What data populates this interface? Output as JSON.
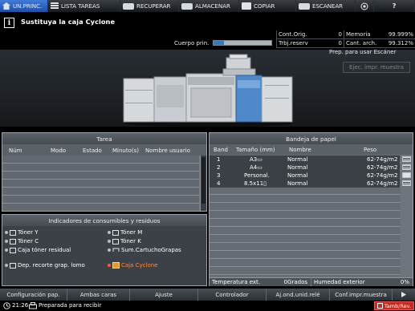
{
  "topbar": {
    "tabs": [
      {
        "label": "UN.PRINC.",
        "icon": "home-icon",
        "active": true
      },
      {
        "label": "LISTA TAREAS",
        "icon": "list-icon",
        "active": false
      },
      {
        "label": "RECUPERAR",
        "icon": "printer-icon",
        "active": false
      },
      {
        "label": "ALMACENAR",
        "icon": "printer-icon",
        "active": false
      },
      {
        "label": "COPIAR",
        "icon": "copy-icon",
        "active": false
      },
      {
        "label": "ESCANEAR",
        "icon": "scanner-icon",
        "active": false
      }
    ],
    "globe_icon": "globe-icon",
    "help_label": "?"
  },
  "message": {
    "icon": "info-icon",
    "text": "Sustituya la caja Cyclone",
    "main_body_label": "Cuerpo prin.",
    "main_body_progress": 0.18
  },
  "counters": {
    "cont_orig_label": "Cont.Orig.",
    "cont_orig_value": "0",
    "memoria_label": "Memoria",
    "memoria_value": "99.999%",
    "trbj_reserv_label": "Trbj.reserv",
    "trbj_reserv_value": "0",
    "cant_arch_label": "Cant. arch.",
    "cant_arch_value": "99.312%"
  },
  "ready_status": "Prep. para usar Escáner",
  "ejec_button": "Ejec. impr. muestra",
  "tarea": {
    "title": "Tarea",
    "columns": [
      "Núm",
      "Modo",
      "Estado",
      "Minuto(s)",
      "Nombre usuario"
    ]
  },
  "consumables": {
    "title": "Indicadores de consumibles y residuos",
    "items_left": [
      "Tóner Y",
      "Tóner C",
      "Caja tóner residual"
    ],
    "items_right": [
      "Tóner M",
      "Tóner K",
      "Sum.CartuchoGrapas"
    ],
    "dep_label": "Dep. recorte grap. lomo",
    "cyclone_label": "Caja Cyclone",
    "alert_color": "#ff8a3d"
  },
  "bandeja": {
    "title": "Bandeja de papel",
    "columns": [
      "Band",
      "Tamaño (mm)",
      "Nombre",
      "Peso"
    ],
    "rows": [
      {
        "band": "1",
        "size": "A3▭",
        "name": "Normal",
        "weight": "62-74g/m2"
      },
      {
        "band": "2",
        "size": "A4▭",
        "name": "Normal",
        "weight": "62-74g/m2"
      },
      {
        "band": "3",
        "size": "Personal.",
        "name": "Normal",
        "weight": "62-74g/m2"
      },
      {
        "band": "4",
        "size": "8.5x11▯",
        "name": "Normal",
        "weight": "62-74g/m2"
      }
    ],
    "temp_label": "Temperatura ext.",
    "temp_value": "0Grados",
    "hum_label": "Humedad exterior",
    "hum_value": "0%"
  },
  "bottom_buttons": [
    "Configuración pap.",
    "Ambas caras",
    "Ajuste",
    "Controlador",
    "Aj.ond.unid.relé",
    "Conf.impr.muestra"
  ],
  "statusline": {
    "time": "21:26",
    "receive_text": "Preparada para recibir",
    "tamb_label": "Tamb/Rev."
  }
}
